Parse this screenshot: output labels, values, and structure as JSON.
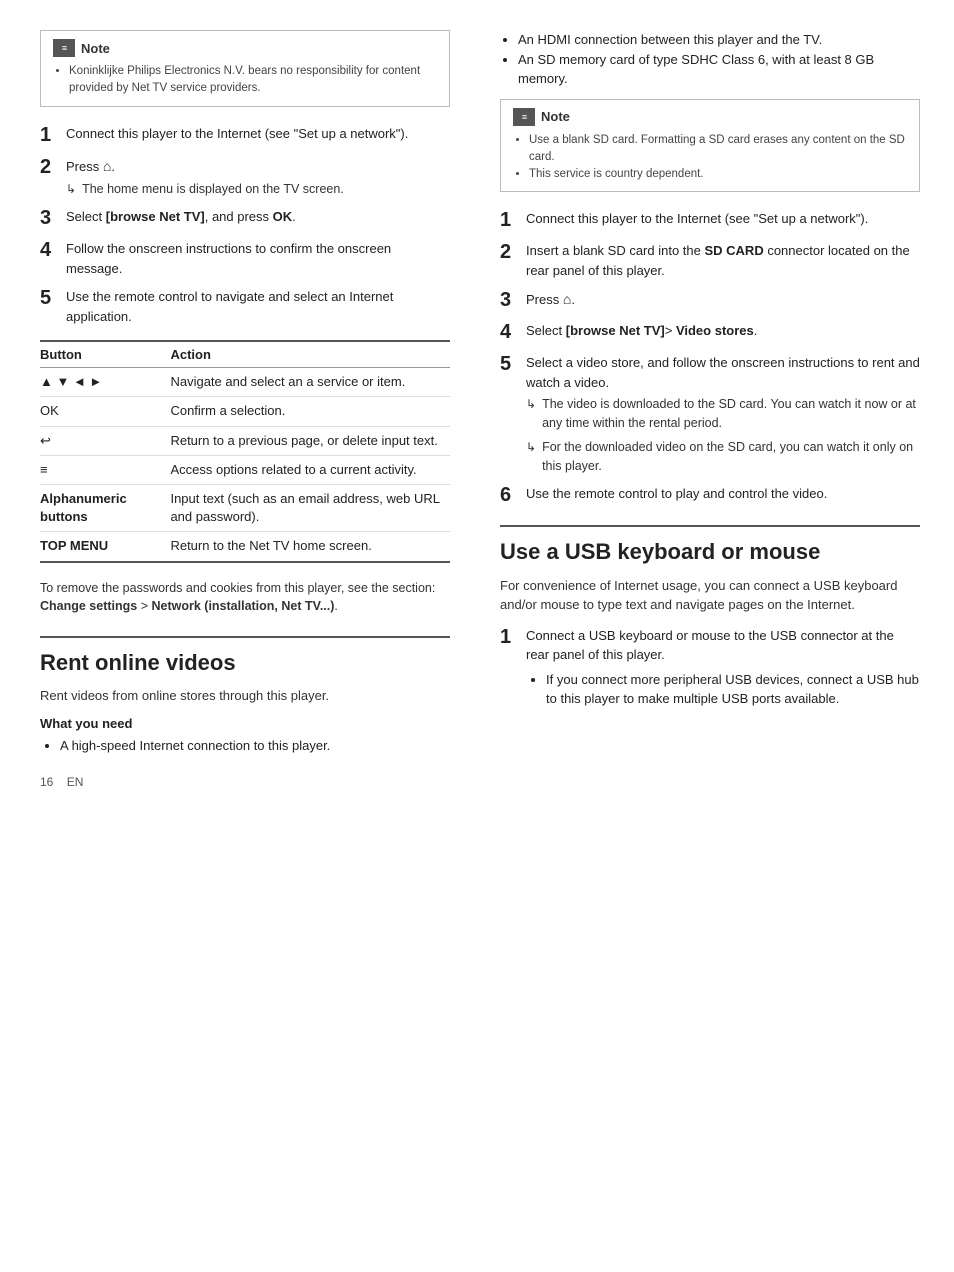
{
  "page": {
    "number": "16",
    "lang": "EN"
  },
  "left_col": {
    "note_box_top": {
      "label": "Note",
      "items": [
        "Koninklijke Philips Electronics N.V. bears no responsibility for content provided by Net TV service providers."
      ]
    },
    "steps_top": [
      {
        "num": "1",
        "text": "Connect this player to the Internet (see \"Set up a network\")."
      },
      {
        "num": "2",
        "text": "Press ⌂.",
        "sub": "The home menu is displayed on the TV screen."
      },
      {
        "num": "3",
        "text": "Select [browse Net TV], and press OK."
      },
      {
        "num": "4",
        "text": "Follow the onscreen instructions to confirm the onscreen message."
      },
      {
        "num": "5",
        "text": "Use the remote control to navigate and select an Internet application."
      }
    ],
    "table": {
      "col1_header": "Button",
      "col2_header": "Action",
      "rows": [
        {
          "button": "▲ ▼ ◄ ►",
          "action": "Navigate and select an a service or item."
        },
        {
          "button": "OK",
          "action": "Confirm a selection."
        },
        {
          "button": "↩",
          "action": "Return to a previous page, or delete input text."
        },
        {
          "button": "≡",
          "action": "Access options related to a current activity."
        },
        {
          "button": "Alphanumeric buttons",
          "action": "Input text (such as an email address, web URL and password)."
        },
        {
          "button": "TOP MENU",
          "action": "Return to the Net TV home screen."
        }
      ]
    },
    "footer_note": "To remove the passwords and cookies from this player, see the section: Change settings > Network (installation, Net TV...).",
    "section_rent": {
      "title": "Rent online videos",
      "desc": "Rent videos from online stores through this player.",
      "what_you_need_title": "What you need",
      "bullets": [
        "A high-speed Internet connection to this player."
      ]
    }
  },
  "right_col": {
    "bullets_top": [
      "An HDMI connection between this player and the TV.",
      "An SD memory card of type SDHC Class 6, with at least 8 GB memory."
    ],
    "note_box": {
      "label": "Note",
      "items": [
        "Use a blank SD card. Formatting a SD card erases any content on the SD card.",
        "This service is country dependent."
      ]
    },
    "steps": [
      {
        "num": "1",
        "text": "Connect this player to the Internet (see \"Set up a network\")."
      },
      {
        "num": "2",
        "text": "Insert a blank SD card into the SD CARD connector located on the rear panel of this player."
      },
      {
        "num": "3",
        "text": "Press ⌂."
      },
      {
        "num": "4",
        "text": "Select [browse Net TV]> Video stores."
      },
      {
        "num": "5",
        "text": "Select a video store, and follow the onscreen instructions to rent and watch a video.",
        "subs": [
          "The video is downloaded to the SD card. You can watch it now or at any time within the rental period.",
          "For the downloaded video on the SD card, you can watch it only on this player."
        ]
      },
      {
        "num": "6",
        "text": "Use the remote control to play and control the video."
      }
    ],
    "section_usb": {
      "title": "Use a USB keyboard or mouse",
      "desc": "For convenience of Internet usage, you can connect a USB keyboard and/or mouse to type text and navigate pages on the Internet.",
      "steps": [
        {
          "num": "1",
          "text": "Connect a USB keyboard or mouse to the USB connector at the rear panel of this player.",
          "bullets": [
            "If you connect more peripheral USB devices, connect a USB hub to this player to make multiple USB ports available."
          ]
        }
      ]
    }
  }
}
